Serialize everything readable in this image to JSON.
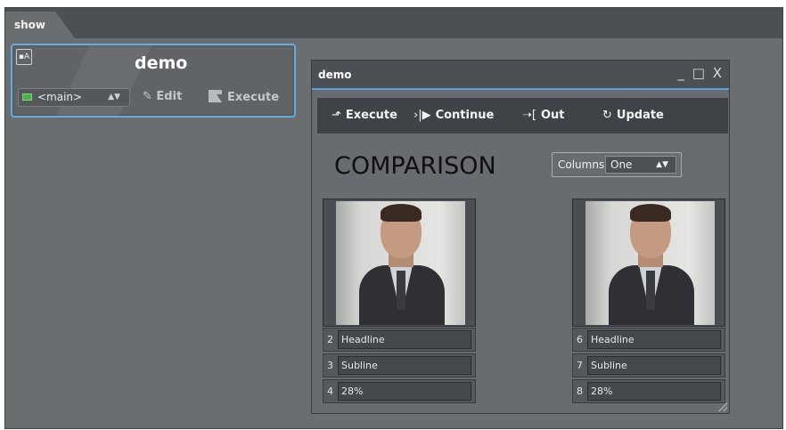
{
  "tab": {
    "label": "show"
  },
  "card": {
    "title": "demo",
    "channel_select": "<main>",
    "edit_label": "Edit",
    "execute_label": "Execute",
    "icon": "template-icon"
  },
  "window": {
    "title": "demo",
    "controls": "_ □ X",
    "toolbar": {
      "execute": "Execute",
      "continue": "Continue",
      "out": "Out",
      "update": "Update"
    },
    "heading": "COMPARISON",
    "columns": {
      "label": "Columns",
      "value": "One"
    },
    "left": {
      "fields": [
        {
          "num": "2",
          "value": "Headline"
        },
        {
          "num": "3",
          "value": "Subline"
        },
        {
          "num": "4",
          "value": "28%"
        }
      ]
    },
    "right": {
      "fields": [
        {
          "num": "6",
          "value": "Headline"
        },
        {
          "num": "7",
          "value": "Subline"
        },
        {
          "num": "8",
          "value": "28%"
        }
      ]
    }
  },
  "colors": {
    "accent": "#5da3d8",
    "panel": "#686b70",
    "toolbar": "#3f4246"
  }
}
